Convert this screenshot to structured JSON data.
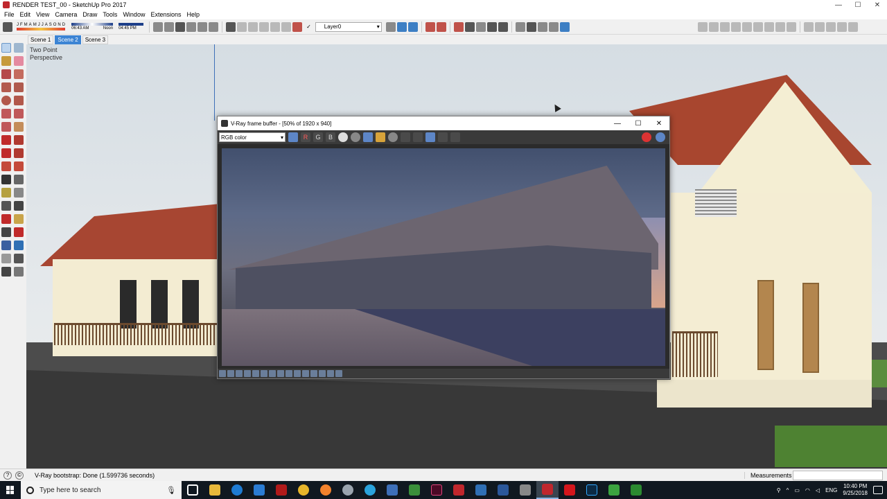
{
  "window": {
    "title": "RENDER TEST_00 - SketchUp Pro 2017",
    "controls": [
      "—",
      "☐",
      "✕"
    ]
  },
  "menu": [
    "File",
    "Edit",
    "View",
    "Camera",
    "Draw",
    "Tools",
    "Window",
    "Extensions",
    "Help"
  ],
  "shadow": {
    "months": [
      "J",
      "F",
      "M",
      "A",
      "M",
      "J",
      "J",
      "A",
      "S",
      "O",
      "N",
      "D"
    ],
    "time_start": "06:43 AM",
    "time_mid": "Noon",
    "time_end": "04:45 PM"
  },
  "layer": {
    "check": "✓",
    "current": "Layer0"
  },
  "scenes": [
    "Scene 1",
    "Scene 2",
    "Scene 3"
  ],
  "active_scene": "Scene 2",
  "viewport": {
    "label_line1": "Two Point",
    "label_line2": "Perspective"
  },
  "vray": {
    "title": "V-Ray frame buffer - [50% of 1920 x 940]",
    "channel": "RGB color",
    "channel_buttons": [
      "R",
      "G",
      "B"
    ]
  },
  "status": {
    "message": "V-Ray bootstrap: Done (1.599736 seconds)",
    "measurements_label": "Measurements"
  },
  "taskbar": {
    "search_placeholder": "Type here to search",
    "language": "ENG",
    "time": "10:40 PM",
    "date": "9/25/2018"
  }
}
